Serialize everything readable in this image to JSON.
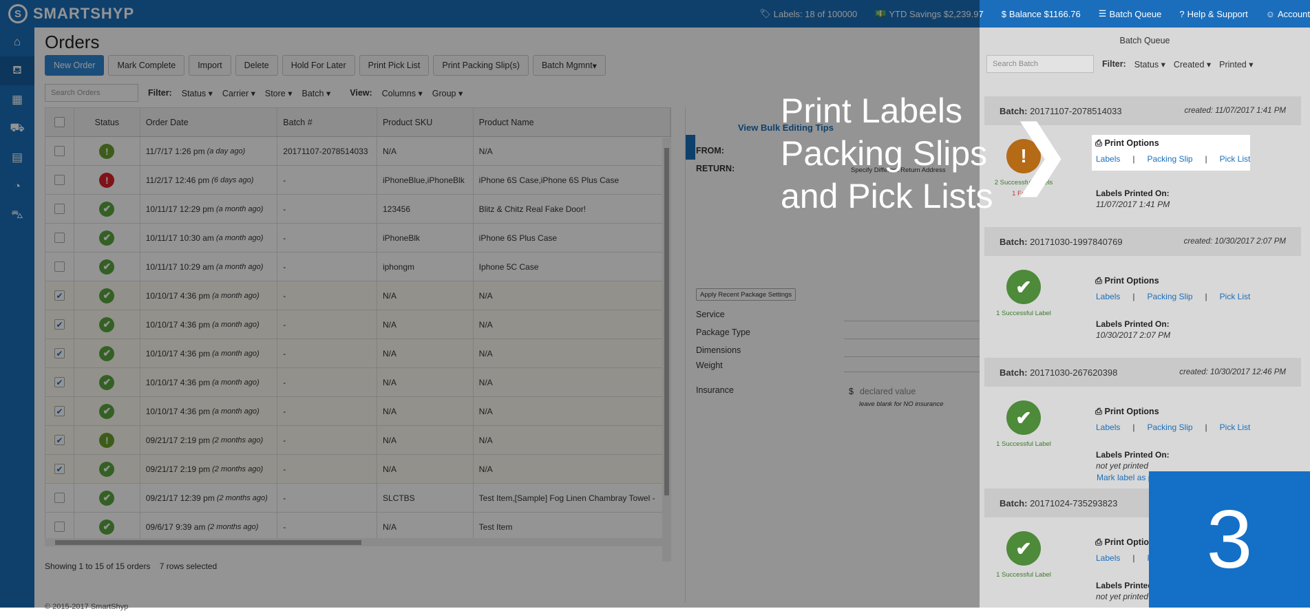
{
  "brand": {
    "name": "SMARTSHYP",
    "logo": "S"
  },
  "topbar": {
    "labels": "Labels: 18 of 100000",
    "ytd": "YTD Savings $2,239.97",
    "balance": "Balance $1166.76",
    "batch_queue": "Batch Queue",
    "help": "Help & Support",
    "account": "Account"
  },
  "sidebar": [
    "home-icon",
    "basket-icon",
    "calendar-icon",
    "truck-icon",
    "address-book-icon",
    "pie-chart-icon",
    "cart-icon"
  ],
  "page": {
    "title": "Orders"
  },
  "toolbar": {
    "new_order": "New Order",
    "mark_complete": "Mark Complete",
    "import": "Import",
    "delete": "Delete",
    "hold": "Hold For Later",
    "print_pick": "Print Pick List",
    "print_slips": "Print Packing Slip(s)",
    "batch_mgmt": "Batch Mgmnt"
  },
  "filters": {
    "search_placeholder": "Search Orders",
    "filter": "Filter:",
    "status": "Status",
    "carrier": "Carrier",
    "store": "Store",
    "batch": "Batch",
    "view": "View:",
    "columns": "Columns",
    "group": "Group"
  },
  "columns": [
    "Status",
    "Order Date",
    "Batch #",
    "Product SKU",
    "Product Name"
  ],
  "rows": [
    {
      "checked": false,
      "status": "warn",
      "date": "11/7/17 1:26 pm",
      "rel": "(a day ago)",
      "batch": "20171107-2078514033",
      "sku": "N/A",
      "name": "N/A"
    },
    {
      "checked": false,
      "status": "err",
      "date": "11/2/17 12:46 pm",
      "rel": "(6 days ago)",
      "batch": "-",
      "sku": "iPhoneBlue,iPhoneBlk",
      "name": "iPhone 6S Case,iPhone 6S Plus Case"
    },
    {
      "checked": false,
      "status": "ok",
      "date": "10/11/17 12:29 pm",
      "rel": "(a month ago)",
      "batch": "-",
      "sku": "123456",
      "name": "Blitz & Chitz Real Fake Door!"
    },
    {
      "checked": false,
      "status": "ok",
      "date": "10/11/17 10:30 am",
      "rel": "(a month ago)",
      "batch": "-",
      "sku": "iPhoneBlk",
      "name": "iPhone 6S Plus Case"
    },
    {
      "checked": false,
      "status": "ok",
      "date": "10/11/17 10:29 am",
      "rel": "(a month ago)",
      "batch": "-",
      "sku": "iphongm",
      "name": "Iphone 5C Case"
    },
    {
      "checked": true,
      "status": "ok",
      "date": "10/10/17 4:36 pm",
      "rel": "(a month ago)",
      "batch": "-",
      "sku": "N/A",
      "name": "N/A"
    },
    {
      "checked": true,
      "status": "ok",
      "date": "10/10/17 4:36 pm",
      "rel": "(a month ago)",
      "batch": "-",
      "sku": "N/A",
      "name": "N/A"
    },
    {
      "checked": true,
      "status": "ok",
      "date": "10/10/17 4:36 pm",
      "rel": "(a month ago)",
      "batch": "-",
      "sku": "N/A",
      "name": "N/A"
    },
    {
      "checked": true,
      "status": "ok",
      "date": "10/10/17 4:36 pm",
      "rel": "(a month ago)",
      "batch": "-",
      "sku": "N/A",
      "name": "N/A"
    },
    {
      "checked": true,
      "status": "ok",
      "date": "10/10/17 4:36 pm",
      "rel": "(a month ago)",
      "batch": "-",
      "sku": "N/A",
      "name": "N/A"
    },
    {
      "checked": true,
      "status": "warn",
      "date": "09/21/17 2:19 pm",
      "rel": "(2 months ago)",
      "batch": "-",
      "sku": "N/A",
      "name": "N/A"
    },
    {
      "checked": true,
      "status": "ok",
      "date": "09/21/17 2:19 pm",
      "rel": "(2 months ago)",
      "batch": "-",
      "sku": "N/A",
      "name": "N/A"
    },
    {
      "checked": false,
      "status": "ok",
      "date": "09/21/17 12:39 pm",
      "rel": "(2 months ago)",
      "batch": "-",
      "sku": "SLCTBS",
      "name": "Test Item,[Sample] Fog Linen Chambray Towel -"
    },
    {
      "checked": false,
      "status": "ok",
      "date": "09/6/17 9:39 am",
      "rel": "(2 months ago)",
      "batch": "-",
      "sku": "N/A",
      "name": "Test Item"
    }
  ],
  "footer": {
    "showing": "Showing 1 to 15 of 15 orders",
    "selected": "7 rows selected",
    "copyright": "© 2015-2017 SmartShyp"
  },
  "detail": {
    "tips": "View Bulk Editing Tips",
    "from": "FROM:",
    "return": "RETURN:",
    "return_btn": "Specify Different Return Address",
    "apply": "Apply Recent Package Settings",
    "service": "Service",
    "package_type": "Package Type",
    "dimensions": "Dimensions",
    "weight": "Weight",
    "insurance": "Insurance",
    "dollar": "$",
    "declared": "declared value",
    "blank": "leave blank for NO insurance"
  },
  "queue": {
    "title": "Batch Queue",
    "search_placeholder": "Search Batch",
    "filter": "Filter:",
    "status": "Status",
    "created": "Created",
    "printed": "Printed",
    "batch_label": "Batch:",
    "print_options": "Print Options",
    "labels": "Labels",
    "packing_slip": "Packing Slip",
    "pick_list": "Pick List",
    "sep": "|",
    "printed_on": "Labels Printed On:",
    "batches": [
      {
        "id": "20171107-2078514033",
        "created": "created: 11/07/2017 1:41 PM",
        "icon": "warn",
        "sub1": "2 Successful Labels",
        "sub2": "1 Failed",
        "printed": "11/07/2017 1:41 PM",
        "mark": ""
      },
      {
        "id": "20171030-1997840769",
        "created": "created: 10/30/2017 2:07 PM",
        "icon": "ok",
        "sub1": "1 Successful Label",
        "sub2": "",
        "printed": "10/30/2017 2:07 PM",
        "mark": ""
      },
      {
        "id": "20171030-267620398",
        "created": "created: 10/30/2017 12:46 PM",
        "icon": "ok",
        "sub1": "1 Successful Label",
        "sub2": "",
        "printed": "not yet printed",
        "mark": "Mark label as printed"
      },
      {
        "id": "20171024-735293823",
        "created": "",
        "icon": "ok",
        "sub1": "1 Successful Label",
        "sub2": "",
        "printed": "not yet printed",
        "mark": ""
      }
    ]
  },
  "callout": {
    "line1": "Print Labels",
    "line2": "Packing Slips",
    "line3": "and Pick Lists",
    "step": "3"
  }
}
